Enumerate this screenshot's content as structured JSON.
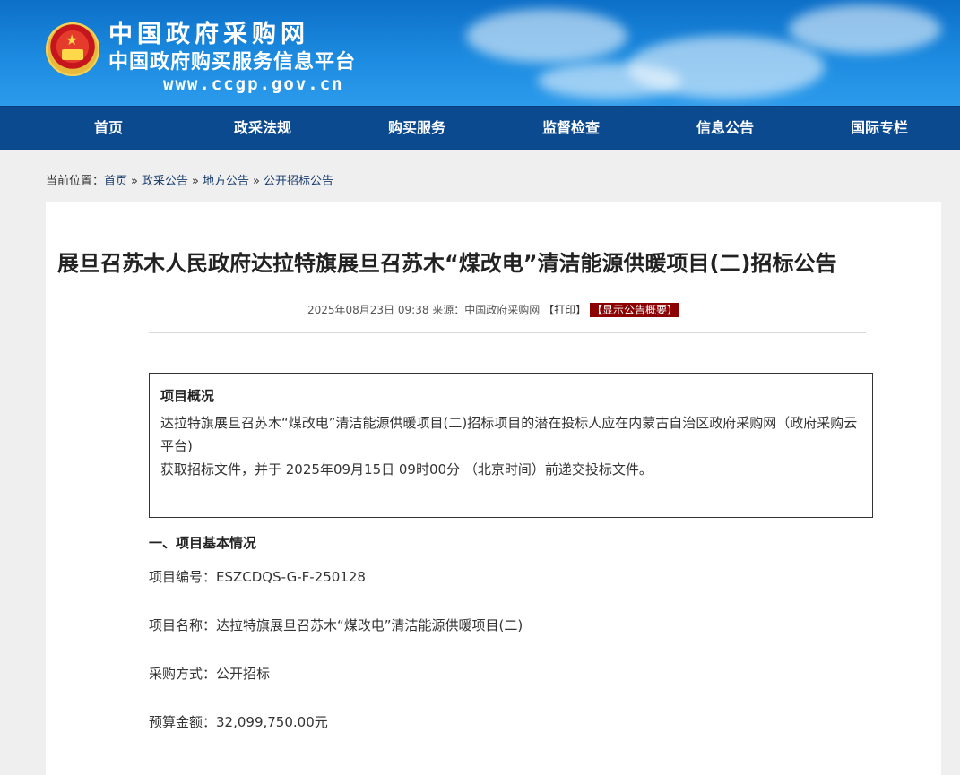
{
  "header": {
    "title": "中国政府采购网",
    "subtitle": "中国政府购买服务信息平台",
    "url": "www.ccgp.gov.cn"
  },
  "nav": [
    "首页",
    "政采法规",
    "购买服务",
    "监督检查",
    "信息公告",
    "国际专栏"
  ],
  "breadcrumb": {
    "label": "当前位置：",
    "items": [
      "首页",
      "政采公告",
      "地方公告",
      "公开招标公告"
    ],
    "separator": "»"
  },
  "article": {
    "title": "展旦召苏木人民政府达拉特旗展旦召苏木“煤改电”清洁能源供暖项目(二)招标公告",
    "date": "2025年08月23日 09:38",
    "source": "来源：中国政府采购网",
    "print_label": "【打印】",
    "summary_label": "【显示公告概要】"
  },
  "overview": {
    "heading": "项目概况",
    "line1": "达拉特旗展旦召苏木“煤改电”清洁能源供暖项目(二)招标项目的潜在投标人应在内蒙古自治区政府采购网（政府采购云平台)",
    "line2": "获取招标文件，并于 2025年09月15日 09时00分 （北京时间）前递交投标文件。"
  },
  "section1": {
    "heading": "一、项目基本情况",
    "fields": [
      "项目编号：ESZCDQS-G-F-250128",
      "项目名称：达拉特旗展旦召苏木“煤改电”清洁能源供暖项目(二)",
      "采购方式：公开招标",
      "预算金额：32,099,750.00元"
    ]
  },
  "colors": {
    "nav_bg": "#0b4a8f",
    "banner": "#1c8be0",
    "summary_btn": "#8b0000"
  }
}
